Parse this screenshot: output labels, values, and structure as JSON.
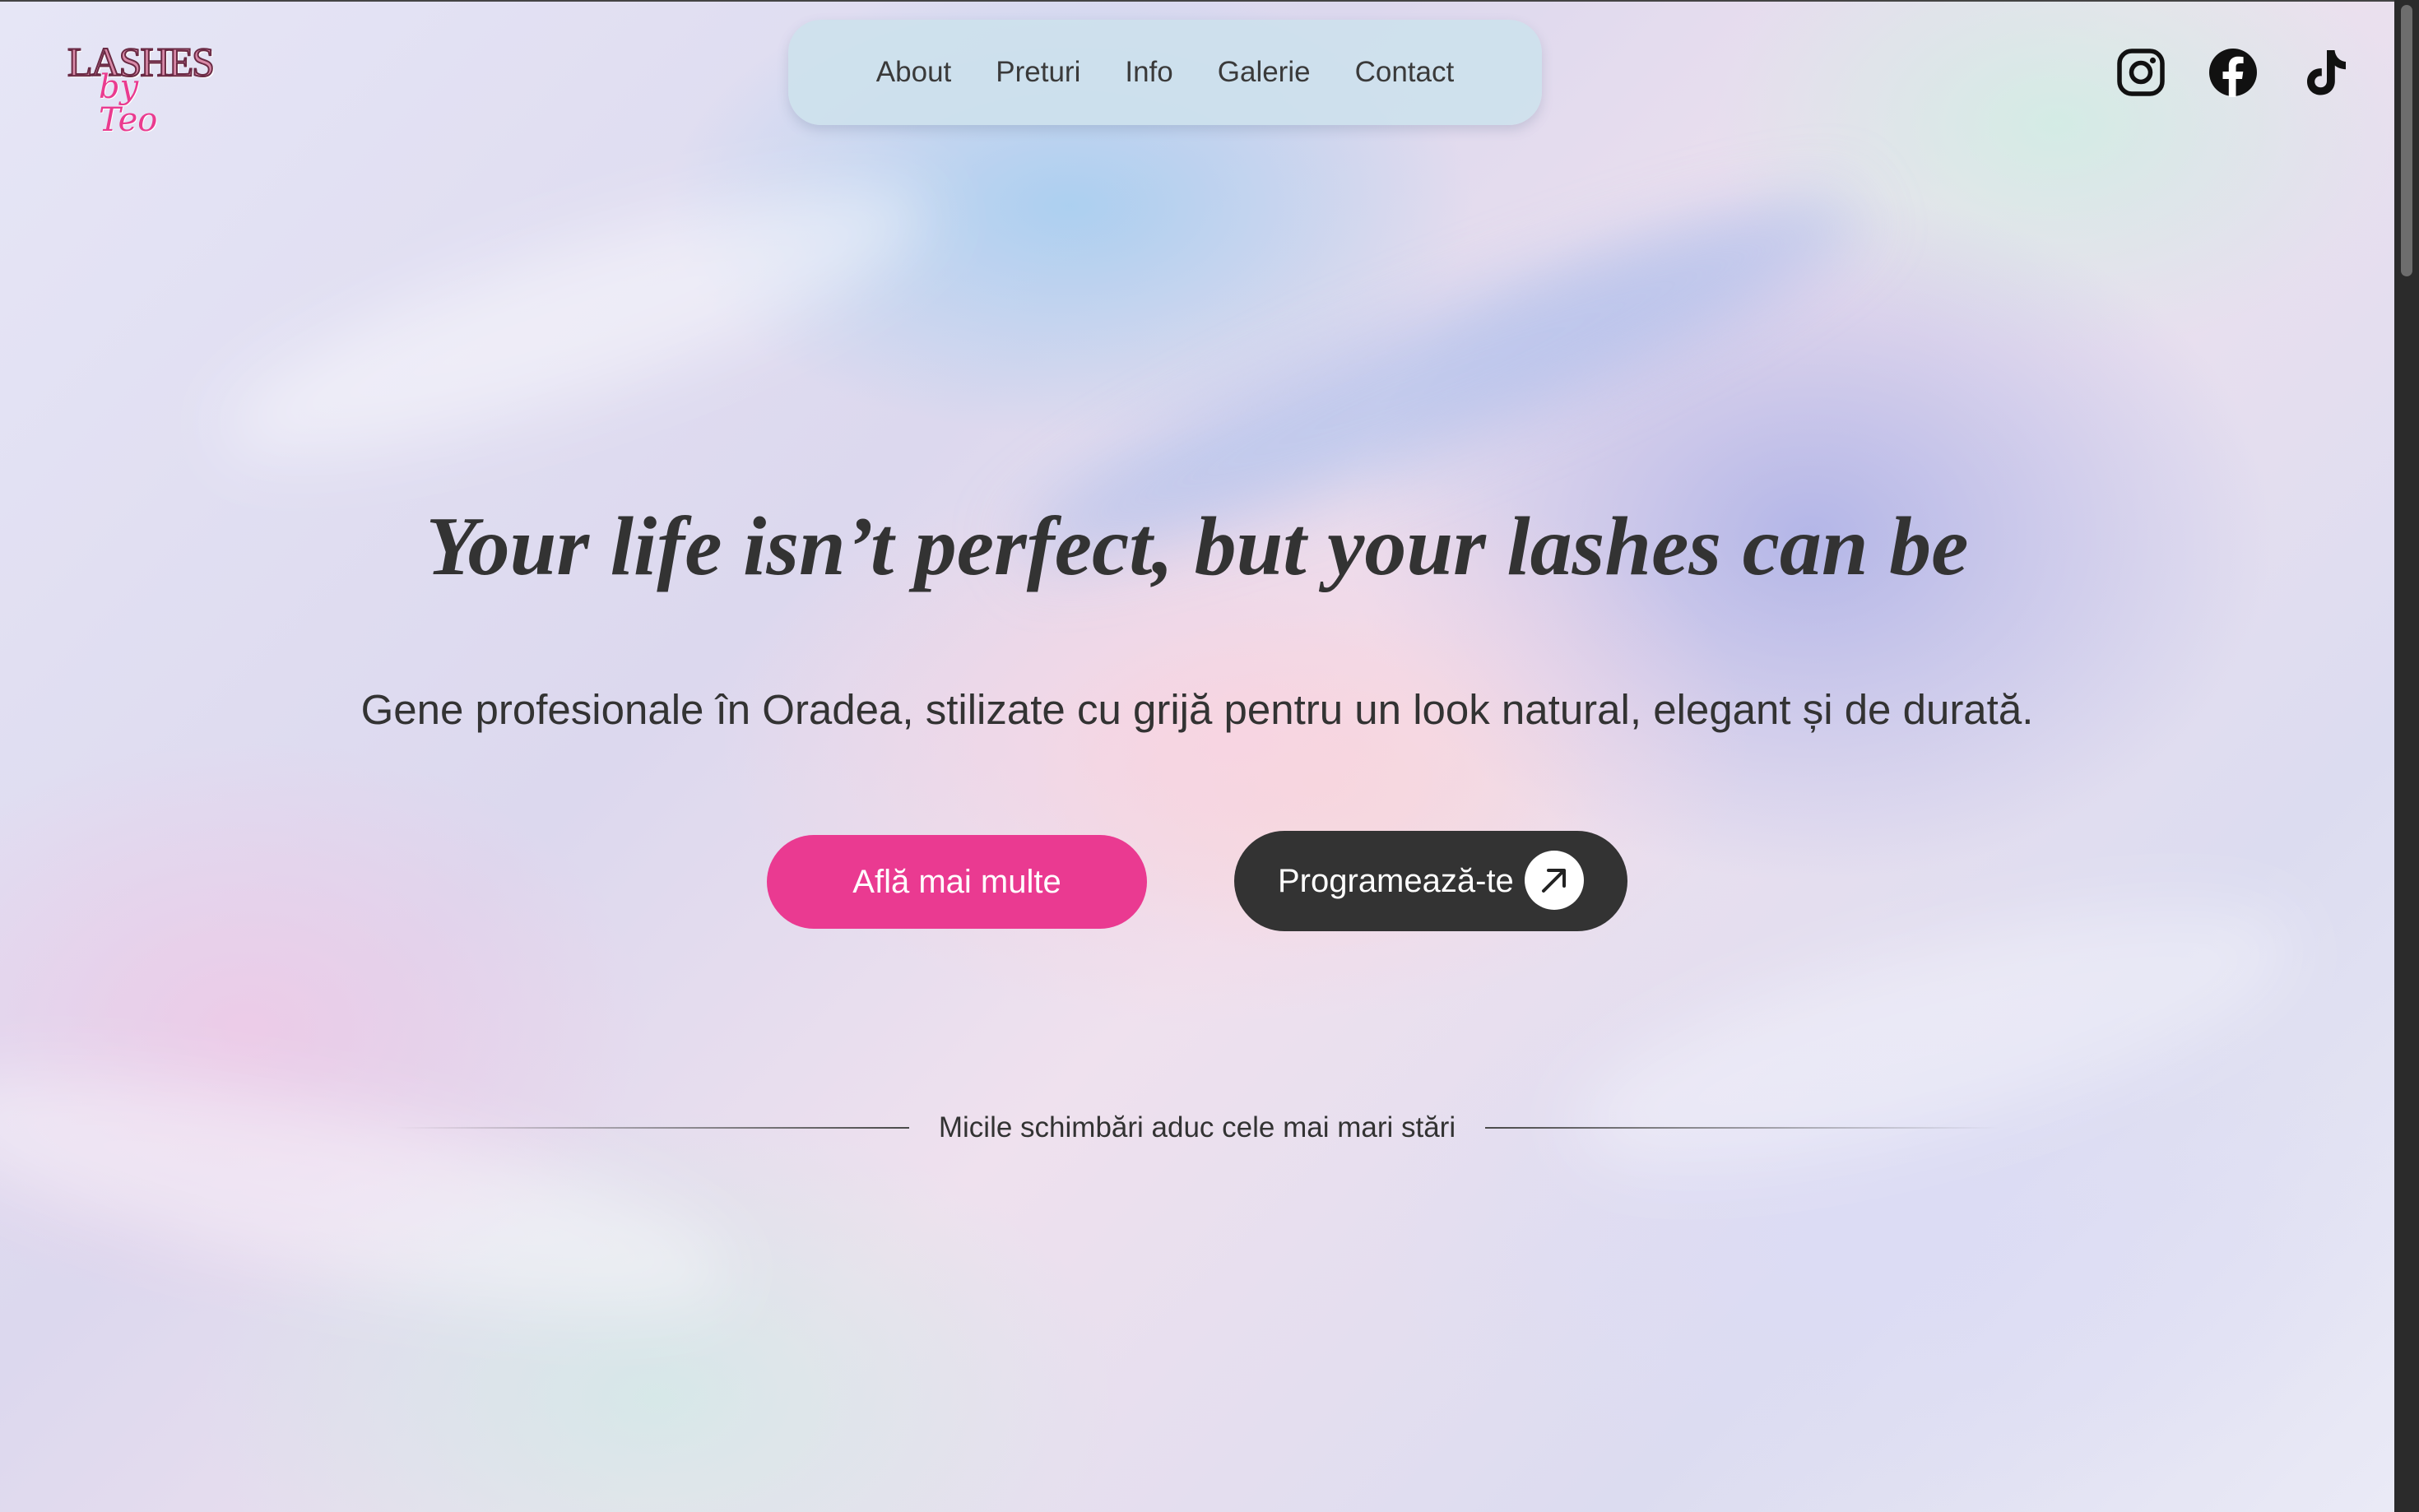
{
  "brand": {
    "logo_line1": "LASHES",
    "logo_line2": "by Teo",
    "accent_color": "#ea3a91",
    "dark_color": "#333333"
  },
  "nav": {
    "items": [
      {
        "label": "About"
      },
      {
        "label": "Preturi"
      },
      {
        "label": "Info"
      },
      {
        "label": "Galerie"
      },
      {
        "label": "Contact"
      }
    ]
  },
  "social": {
    "icons": [
      "instagram-icon",
      "facebook-icon",
      "tiktok-icon"
    ]
  },
  "hero": {
    "title": "Your life isn’t perfect, but your lashes can be",
    "subtitle": "Gene profesionale în Oradea, stilizate cu grijă pentru un look natural, elegant și de durată.",
    "primary_button": "Află mai multe",
    "secondary_button": "Programează-te",
    "secondary_button_icon": "arrow-up-right-icon"
  },
  "tagline": "Micile schimbări aduc cele mai mari stări"
}
